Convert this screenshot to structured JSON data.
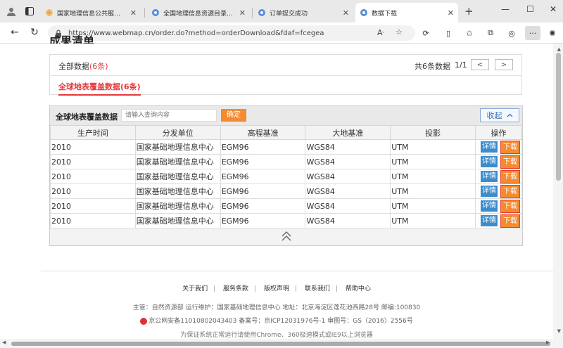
{
  "browser": {
    "tabs": [
      {
        "label": "国家地理信息公共服务平台 天"
      },
      {
        "label": "全国地理信息资源目录服务系"
      },
      {
        "label": "订单提交成功"
      },
      {
        "label": "数据下载"
      }
    ],
    "new_tab": "+",
    "url": "https://www.webmap.cn/order.do?method=orderDownload&fdaf=fcegea",
    "colors": {
      "tabstrip": "#e9e9e9",
      "accent": "#3c8dcc"
    }
  },
  "page": {
    "section_title": "成果清单",
    "all_data_label": "全部数据",
    "all_data_count": "(6条)",
    "total": "共6条数据",
    "page_current": "1",
    "page_sep": "/",
    "page_total": "1",
    "prev": "<",
    "next": ">",
    "category_tab": "全球地表覆盖数据(6条)"
  },
  "panel": {
    "title": "全球地表覆盖数据",
    "search_placeholder": "请输入查询内容",
    "confirm_label": "确定",
    "collapse_label": "收起",
    "columns": [
      "生产时间",
      "分发单位",
      "高程基准",
      "大地基准",
      "投影",
      "操作"
    ],
    "rows": [
      {
        "time": "2010",
        "unit": "国家基础地理信息中心",
        "elev": "EGM96",
        "geo": "WGS84",
        "proj": "UTM"
      },
      {
        "time": "2010",
        "unit": "国家基础地理信息中心",
        "elev": "EGM96",
        "geo": "WGS84",
        "proj": "UTM"
      },
      {
        "time": "2010",
        "unit": "国家基础地理信息中心",
        "elev": "EGM96",
        "geo": "WGS84",
        "proj": "UTM"
      },
      {
        "time": "2010",
        "unit": "国家基础地理信息中心",
        "elev": "EGM96",
        "geo": "WGS84",
        "proj": "UTM"
      },
      {
        "time": "2010",
        "unit": "国家基础地理信息中心",
        "elev": "EGM96",
        "geo": "WGS84",
        "proj": "UTM"
      },
      {
        "time": "2010",
        "unit": "国家基础地理信息中心",
        "elev": "EGM96",
        "geo": "WGS84",
        "proj": "UTM"
      }
    ],
    "detail_label": "详情",
    "download_label": "下载"
  },
  "footer": {
    "links": [
      "关于我们",
      "服务条款",
      "版权声明",
      "联系我们",
      "帮助中心"
    ],
    "line1": "主管：自然资源部 运行维护：国家基础地理信息中心 地址：北京海淀区莲花池西路28号 邮编:100830",
    "line2": "京公网安备11010802043403 备案号：京ICP12031976号-1 审图号：GS（2016）2556号",
    "line3": "为保证系统正常运行请使用Chrome、360极速模式或IE9以上浏览器"
  }
}
